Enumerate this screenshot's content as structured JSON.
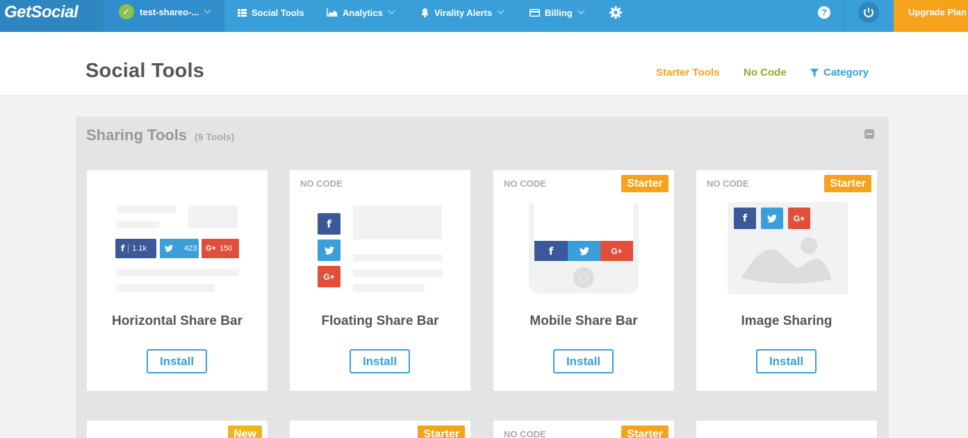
{
  "nav": {
    "logo": "GetSocial",
    "site_name": "test-shareo-...",
    "items": [
      {
        "label": "Social Tools"
      },
      {
        "label": "Analytics"
      },
      {
        "label": "Virality Alerts"
      },
      {
        "label": "Billing"
      }
    ],
    "help": "?",
    "upgrade": "Upgrade Plan"
  },
  "header": {
    "title": "Social Tools",
    "filters": {
      "starter": "Starter Tools",
      "nocode": "No Code",
      "category": "Category"
    }
  },
  "panel": {
    "title": "Sharing Tools",
    "count": "(9 Tools)"
  },
  "cards": [
    {
      "title": "Horizontal Share Bar",
      "install": "Install",
      "counts": {
        "facebook": "1.1k",
        "twitter": "423",
        "google": "150"
      }
    },
    {
      "title": "Floating Share Bar",
      "install": "Install",
      "tag": "NO CODE"
    },
    {
      "title": "Mobile Share Bar",
      "install": "Install",
      "tag": "NO CODE",
      "badge": "Starter"
    },
    {
      "title": "Image Sharing",
      "install": "Install",
      "tag": "NO CODE",
      "badge": "Starter"
    }
  ],
  "row2": [
    {
      "badge": "New"
    },
    {
      "badge": "Starter"
    },
    {
      "tag": "NO CODE",
      "badge": "Starter"
    },
    {}
  ],
  "colors": {
    "nav": "#3a9fd8",
    "accent_orange": "#f7a21b",
    "nocode_green": "#8bab2e",
    "facebook": "#3b5998",
    "twitter": "#3a9fd8",
    "google": "#e14f3b"
  }
}
